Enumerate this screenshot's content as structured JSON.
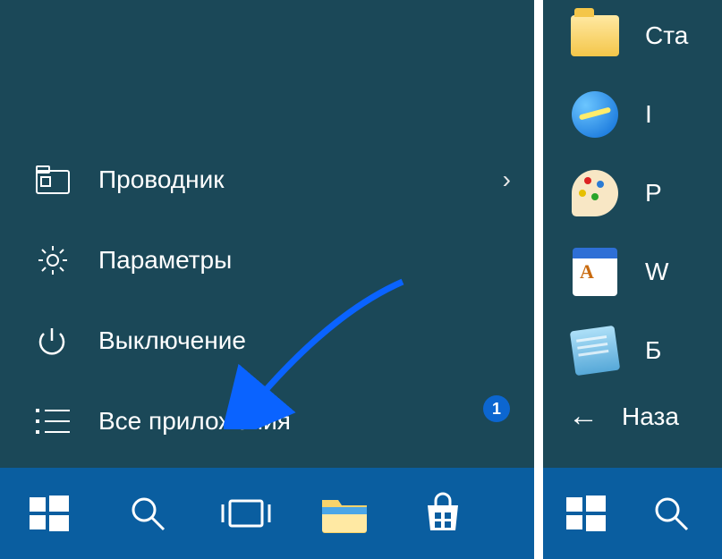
{
  "left": {
    "items": [
      {
        "label": "Проводник",
        "icon": "explorer",
        "has_more": true
      },
      {
        "label": "Параметры",
        "icon": "settings",
        "has_more": false
      },
      {
        "label": "Выключение",
        "icon": "power",
        "has_more": false
      },
      {
        "label": "Все приложения",
        "icon": "all-apps",
        "has_more": false
      }
    ],
    "badge": "1"
  },
  "right": {
    "apps": [
      {
        "label": "Ста",
        "icon": "folder"
      },
      {
        "label": "I",
        "icon": "ie"
      },
      {
        "label": "P",
        "icon": "paint"
      },
      {
        "label": "W",
        "icon": "wordpad"
      },
      {
        "label": "Б",
        "icon": "notepad"
      }
    ],
    "back_label": "Наза"
  },
  "taskbar": {
    "left": [
      "start",
      "search",
      "taskview",
      "file-explorer",
      "store"
    ],
    "right": [
      "start",
      "search"
    ]
  }
}
